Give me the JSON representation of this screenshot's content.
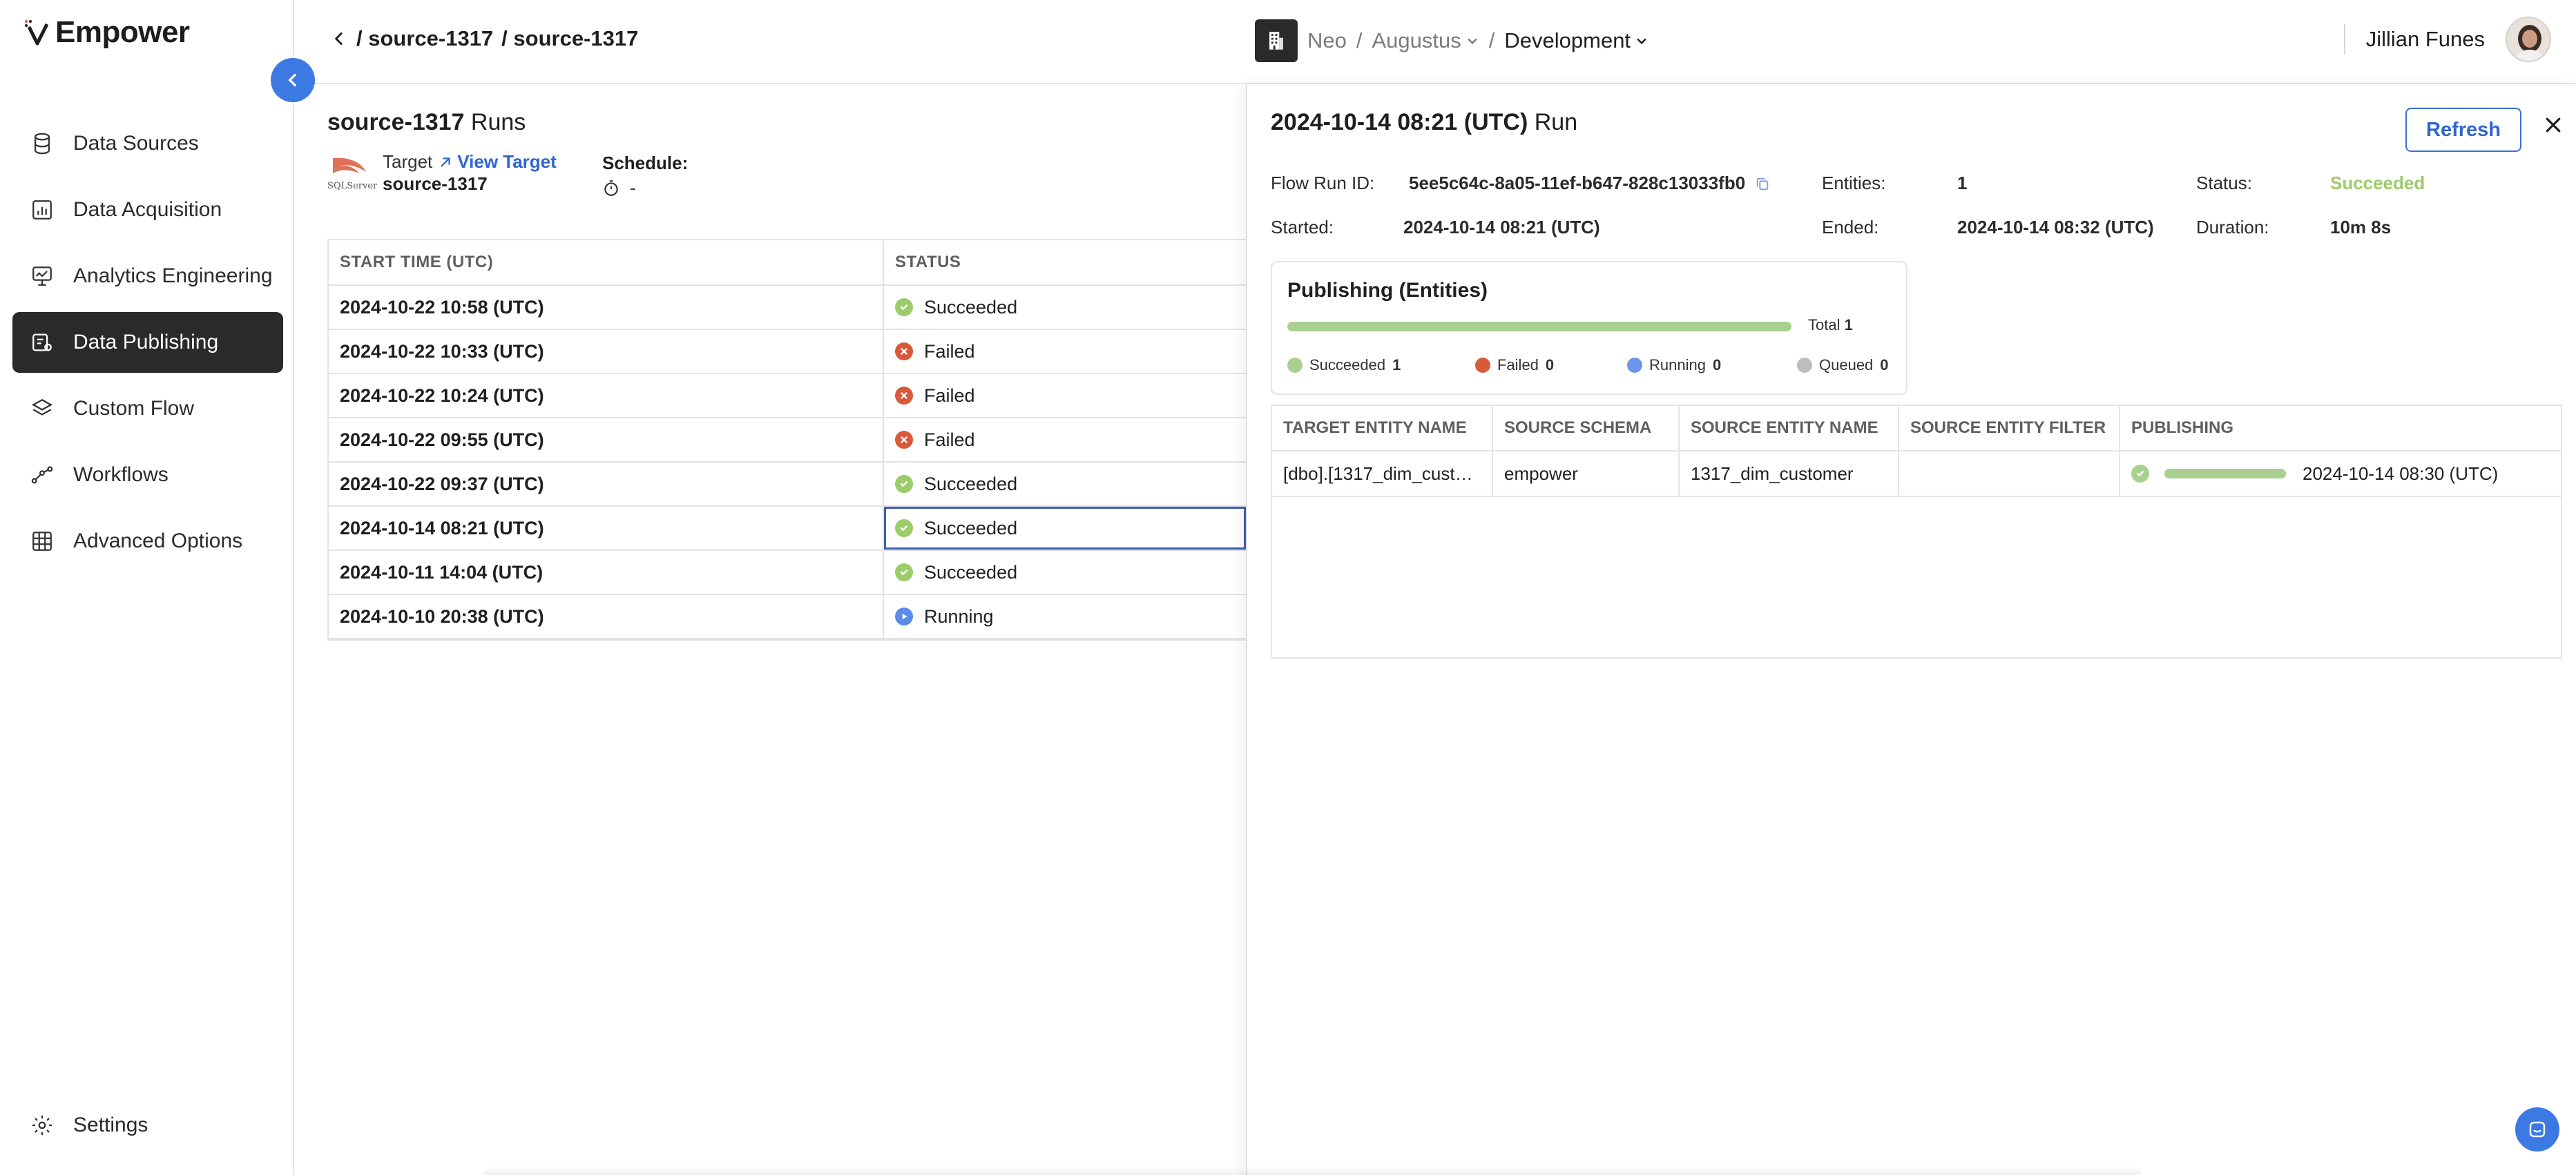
{
  "app": {
    "name": "Empower"
  },
  "sidebar": {
    "items": [
      {
        "label": "Data Sources",
        "icon": "database-icon"
      },
      {
        "label": "Data Acquisition",
        "icon": "bar-chart-icon"
      },
      {
        "label": "Analytics Engineering",
        "icon": "analytics-icon"
      },
      {
        "label": "Data Publishing",
        "icon": "publish-icon",
        "active": true
      },
      {
        "label": "Custom Flow",
        "icon": "layers-icon"
      },
      {
        "label": "Workflows",
        "icon": "workflow-icon"
      },
      {
        "label": "Advanced Options",
        "icon": "grid-icon"
      }
    ],
    "settings_label": "Settings"
  },
  "header": {
    "crumbs": [
      "/ source-1317",
      "/ source-1317"
    ],
    "workspace": {
      "org": "Neo",
      "sep1": "/",
      "project": "Augustus",
      "sep2": "/",
      "env": "Development"
    },
    "user_name": "Jillian Funes"
  },
  "main": {
    "title_bold": "source-1317",
    "title_rest": " Runs",
    "target_label": "Target",
    "view_target_label": "View Target",
    "target_name": "source-1317",
    "db_logo_text": "SQLServer",
    "schedule_label": "Schedule:",
    "schedule_value": "-",
    "columns": [
      "START TIME (UTC)",
      "STATUS"
    ],
    "rows": [
      {
        "start": "2024-10-22 10:58 (UTC)",
        "status": "Succeeded",
        "kind": "ok"
      },
      {
        "start": "2024-10-22 10:33 (UTC)",
        "status": "Failed",
        "kind": "fail"
      },
      {
        "start": "2024-10-22 10:24 (UTC)",
        "status": "Failed",
        "kind": "fail"
      },
      {
        "start": "2024-10-22 09:55 (UTC)",
        "status": "Failed",
        "kind": "fail"
      },
      {
        "start": "2024-10-22 09:37 (UTC)",
        "status": "Succeeded",
        "kind": "ok"
      },
      {
        "start": "2024-10-14 08:21 (UTC)",
        "status": "Succeeded",
        "kind": "ok",
        "selected": true
      },
      {
        "start": "2024-10-11 14:04 (UTC)",
        "status": "Succeeded",
        "kind": "ok"
      },
      {
        "start": "2024-10-10 20:38 (UTC)",
        "status": "Running",
        "kind": "run"
      }
    ]
  },
  "panel": {
    "title_bold": "2024-10-14 08:21 (UTC)",
    "title_rest": " Run",
    "refresh_label": "Refresh",
    "flow_run_id_label": "Flow Run ID:",
    "flow_run_id": "5ee5c64c-8a05-11ef-b647-828c13033fb0",
    "entities_label": "Entities:",
    "entities": "1",
    "status_label": "Status:",
    "status": "Succeeded",
    "started_label": "Started:",
    "started": "2024-10-14 08:21 (UTC)",
    "ended_label": "Ended:",
    "ended": "2024-10-14 08:32 (UTC)",
    "duration_label": "Duration:",
    "duration": "10m 8s",
    "publishing": {
      "title": "Publishing (Entities)",
      "progress_fraction": 1.0,
      "total_label": "Total",
      "total": "1",
      "legend": [
        {
          "label": "Succeeded",
          "count": "1",
          "color": "#a9d08e"
        },
        {
          "label": "Failed",
          "count": "0",
          "color": "#d9593b"
        },
        {
          "label": "Running",
          "count": "0",
          "color": "#6b96ec"
        },
        {
          "label": "Queued",
          "count": "0",
          "color": "#bdbdbd"
        }
      ]
    },
    "entity_columns": [
      "TARGET ENTITY NAME",
      "SOURCE SCHEMA",
      "SOURCE ENTITY NAME",
      "SOURCE ENTITY FILTER",
      "PUBLISHING"
    ],
    "entity_row": {
      "target_entity": "[dbo].[1317_dim_cust…",
      "source_schema": "empower",
      "source_entity": "1317_dim_customer",
      "source_filter": "",
      "publishing_fraction": 1.0,
      "publishing_time": "2024-10-14 08:30 (UTC)"
    }
  },
  "colors": {
    "accent": "#3d79e3",
    "success": "#9ccb6a",
    "fail": "#d9593b",
    "running": "#5b8ae8",
    "active_nav": "#2a2a2a"
  }
}
